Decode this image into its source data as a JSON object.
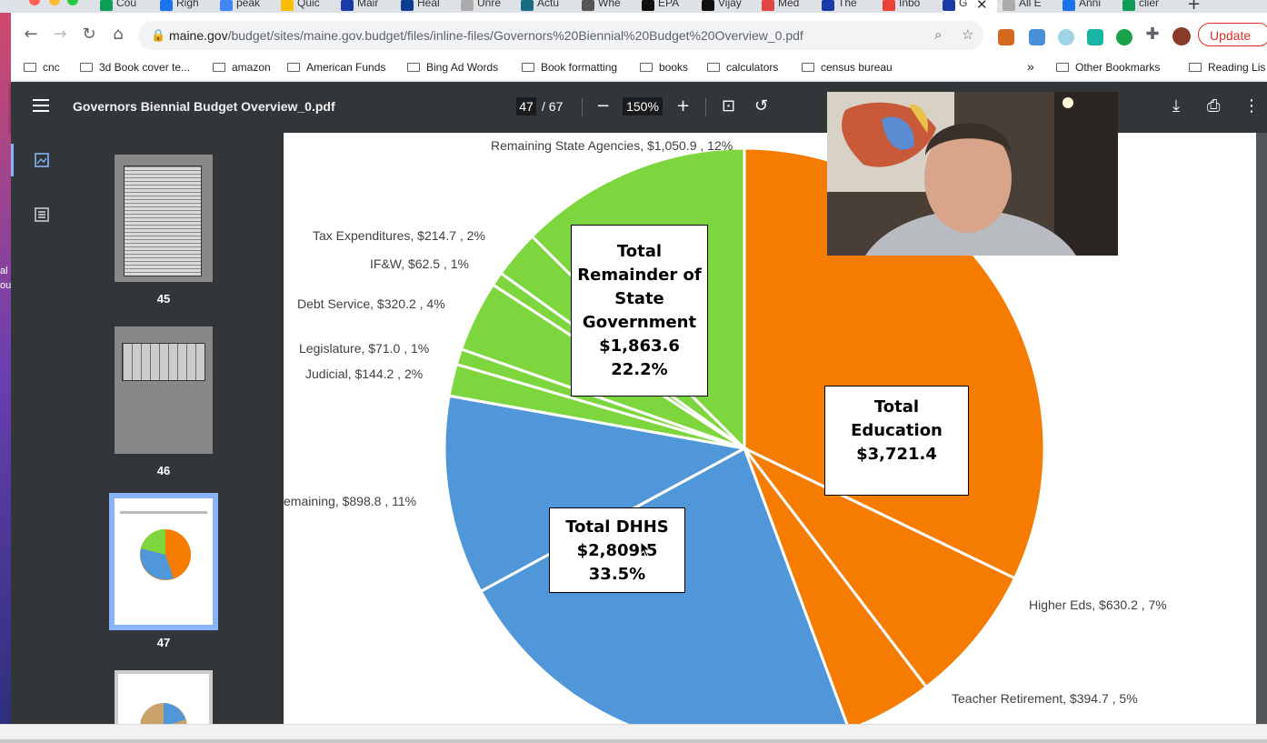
{
  "desktop": {
    "fragments": [
      "al i",
      "ou"
    ]
  },
  "tabs": [
    {
      "label": "Cou",
      "color": "#0f9d58"
    },
    {
      "label": "Righ",
      "color": "#1a73e8"
    },
    {
      "label": "peak",
      "color": "#4285f4"
    },
    {
      "label": "Quic",
      "color": "#fbbc04"
    },
    {
      "label": "Mair",
      "color": "#1a3aa8"
    },
    {
      "label": "Heal",
      "color": "#0b3d91"
    },
    {
      "label": "Unre",
      "color": "#aaaaaa"
    },
    {
      "label": "Actu",
      "color": "#1b6b85"
    },
    {
      "label": "Whe",
      "color": "#555555"
    },
    {
      "label": "EPA",
      "color": "#111111"
    },
    {
      "label": "Vijay",
      "color": "#111111"
    },
    {
      "label": "Med",
      "color": "#e04444"
    },
    {
      "label": "The",
      "color": "#1a3aa8"
    },
    {
      "label": "Inbo",
      "color": "#ea4335"
    },
    {
      "label": "G",
      "color": "#1a3aa8"
    },
    {
      "label": "All E",
      "color": "#aaaaaa"
    },
    {
      "label": "Anni",
      "color": "#1a73e8"
    },
    {
      "label": "clier",
      "color": "#0f9d58"
    }
  ],
  "toolbar": {
    "url_domain": "maine.gov",
    "url_path": "/budget/sites/maine.gov.budget/files/inline-files/Governors%20Biennial%20Budget%20Overview_0.pdf",
    "update_label": "Update"
  },
  "bookmarks": {
    "items": [
      "cnc",
      "3d Book cover te...",
      "amazon",
      "American Funds",
      "Bing Ad Words",
      "Book formatting",
      "books",
      "calculators",
      "census bureau"
    ],
    "overflow": "»",
    "other": "Other Bookmarks",
    "reading": "Reading Lis"
  },
  "pdf": {
    "title": "Governors Biennial Budget Overview_0.pdf",
    "page_current": "47",
    "page_total": "/ 67",
    "zoom": "150%"
  },
  "thumbnails": [
    {
      "num": "45"
    },
    {
      "num": "46"
    },
    {
      "num": "47"
    }
  ],
  "chart_data": {
    "type": "pie",
    "labels": [
      "Remaining State Agencies, $1,050.9 , 12%",
      "Tax Expenditures, $214.7 , 2%",
      "IF&W, $62.5 , 1%",
      "Debt Service, $320.2 , 4%",
      "Legislature, $71.0 , 1%",
      "Judicial, $144.2 , 2%",
      "emaining, $898.8 , 11%",
      "Higher Eds, $630.2 , 7%",
      "Teacher Retirement, $394.7 , 5%",
      "%"
    ],
    "slices": [
      {
        "group": "Total Education",
        "value": 2696.5,
        "color": "#f57c00"
      },
      {
        "group": "Higher Eds",
        "value": 630.2,
        "color": "#f57c00"
      },
      {
        "group": "Teacher Retirement",
        "value": 394.7,
        "color": "#f57c00"
      },
      {
        "group": "DHHS",
        "value": 1910.8,
        "color": "#4f97d9"
      },
      {
        "group": "DHHS remaining",
        "value": 898.8,
        "color": "#4f97d9"
      },
      {
        "group": "Judicial",
        "value": 144.2,
        "color": "#7ed63f"
      },
      {
        "group": "Legislature",
        "value": 71.0,
        "color": "#7ed63f"
      },
      {
        "group": "Debt Service",
        "value": 320.2,
        "color": "#7ed63f"
      },
      {
        "group": "IF&W",
        "value": 62.5,
        "color": "#7ed63f"
      },
      {
        "group": "Tax Expenditures",
        "value": 214.7,
        "color": "#7ed63f"
      },
      {
        "group": "Remaining State Agencies",
        "value": 1050.9,
        "color": "#7ed63f"
      }
    ],
    "boxes": {
      "education": [
        "Total",
        "Education",
        "$3,721.4"
      ],
      "dhhs": [
        "Total DHHS",
        "$2,809.5",
        "33.5%"
      ],
      "remainder": [
        "Total",
        "Remainder of",
        "State",
        "Government",
        "$1,863.6",
        "22.2%"
      ]
    }
  }
}
